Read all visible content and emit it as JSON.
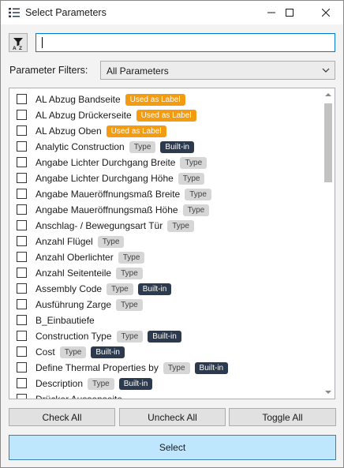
{
  "window": {
    "title": "Select Parameters",
    "controls": {
      "minimize": "minimize",
      "maximize": "maximize",
      "close": "close"
    }
  },
  "toolbar": {
    "sort_icon": "sort-az-icon",
    "search_value": "",
    "search_placeholder": ""
  },
  "filter": {
    "label": "Parameter Filters:",
    "selected": "All Parameters"
  },
  "badge_colors": {
    "Used as Label": "#f39c12",
    "Type": "#d6d6d6",
    "Built-in": "#2b3a4e"
  },
  "parameters": [
    {
      "name": "AL Abzug Bandseite",
      "checked": false,
      "badges": [
        "Used as Label"
      ]
    },
    {
      "name": "AL Abzug Drückerseite",
      "checked": false,
      "badges": [
        "Used as Label"
      ]
    },
    {
      "name": "AL Abzug Oben",
      "checked": false,
      "badges": [
        "Used as Label"
      ]
    },
    {
      "name": "Analytic Construction",
      "checked": false,
      "badges": [
        "Type",
        "Built-in"
      ]
    },
    {
      "name": "Angabe Lichter Durchgang Breite",
      "checked": false,
      "badges": [
        "Type"
      ]
    },
    {
      "name": "Angabe Lichter Durchgang Höhe",
      "checked": false,
      "badges": [
        "Type"
      ]
    },
    {
      "name": "Angabe Maueröffnungsmaß Breite",
      "checked": false,
      "badges": [
        "Type"
      ]
    },
    {
      "name": "Angabe Maueröffnungsmaß Höhe",
      "checked": false,
      "badges": [
        "Type"
      ]
    },
    {
      "name": "Anschlag- / Bewegungsart Tür",
      "checked": false,
      "badges": [
        "Type"
      ]
    },
    {
      "name": "Anzahl Flügel",
      "checked": false,
      "badges": [
        "Type"
      ]
    },
    {
      "name": "Anzahl Oberlichter",
      "checked": false,
      "badges": [
        "Type"
      ]
    },
    {
      "name": "Anzahl Seitenteile",
      "checked": false,
      "badges": [
        "Type"
      ]
    },
    {
      "name": "Assembly Code",
      "checked": false,
      "badges": [
        "Type",
        "Built-in"
      ]
    },
    {
      "name": "Ausführung Zarge",
      "checked": false,
      "badges": [
        "Type"
      ]
    },
    {
      "name": "B_Einbautiefe",
      "checked": false,
      "badges": []
    },
    {
      "name": "Construction Type",
      "checked": false,
      "badges": [
        "Type",
        "Built-in"
      ]
    },
    {
      "name": "Cost",
      "checked": false,
      "badges": [
        "Type",
        "Built-in"
      ]
    },
    {
      "name": "Define Thermal Properties by",
      "checked": false,
      "badges": [
        "Type",
        "Built-in"
      ]
    },
    {
      "name": "Description",
      "checked": false,
      "badges": [
        "Type",
        "Built-in"
      ]
    },
    {
      "name": "Drücker Aussenseite",
      "checked": false,
      "badges": []
    }
  ],
  "actions": {
    "check_all": "Check All",
    "uncheck_all": "Uncheck All",
    "toggle_all": "Toggle All",
    "select": "Select"
  }
}
